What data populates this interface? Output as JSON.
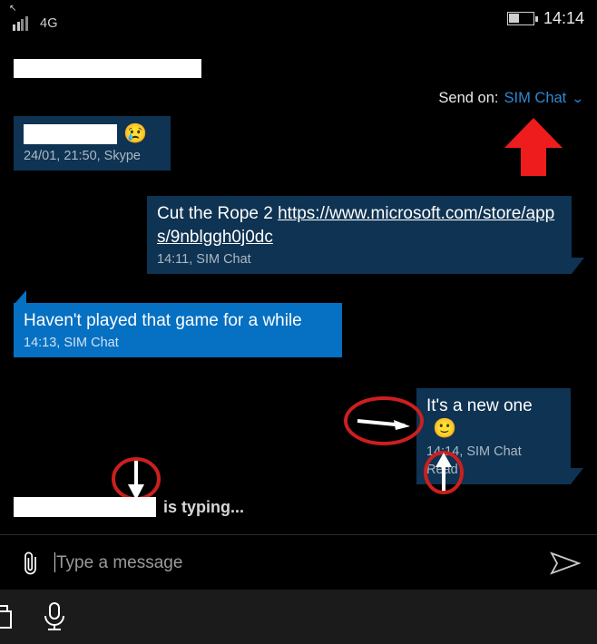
{
  "statusbar": {
    "network_label": "4G",
    "clock": "14:14",
    "signal_icon": "signal-bars-icon",
    "roaming_icon": "roaming-arrow-icon",
    "battery_icon": "battery-icon"
  },
  "header": {
    "contact_name_redacted": "",
    "send_on_label": "Send on:",
    "send_on_value": "SIM Chat",
    "chevron": "⌄"
  },
  "messages": [
    {
      "id": "skype",
      "direction": "out",
      "text_redacted": "",
      "emoji": "😢",
      "meta": "24/01, 21:50, Skype"
    },
    {
      "id": "link",
      "direction": "out",
      "text_prefix": "Cut the Rope 2 ",
      "link": "https://www.microsoft.com/store/apps/9nblggh0j0dc",
      "meta": "14:11, SIM Chat"
    },
    {
      "id": "reply",
      "direction": "in",
      "text": "Haven't played that game for a while",
      "meta": "14:13, SIM Chat"
    },
    {
      "id": "new",
      "direction": "out",
      "text": "It's a new one",
      "emoji": "🙂",
      "meta": "14:14, SIM Chat",
      "receipt": "Read"
    }
  ],
  "typing": {
    "name_redacted": "",
    "text": "is typing..."
  },
  "composer": {
    "attach_icon": "paperclip-icon",
    "placeholder": "Type a message",
    "send_icon": "send-icon"
  },
  "navbar": {
    "left_icon": "camera-icon",
    "mic_icon": "microphone-icon"
  },
  "annotations": {
    "red_arrow_up_sendon": "red-up-arrow",
    "ellipse_right_arrow": "white-right-arrow",
    "circle_up_arrow": "white-up-arrow",
    "ellipse_down_arrow": "white-down-arrow"
  },
  "colors": {
    "background": "#000000",
    "bubble_out": "#0f3352",
    "bubble_in": "#0670c3",
    "accent_blue": "#2f87d4",
    "annotation_red": "#cc1f1f",
    "arrow_red": "#ee1c1c"
  }
}
